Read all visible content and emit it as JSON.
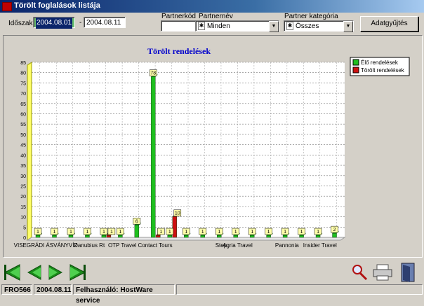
{
  "window": {
    "title": "Törölt foglalások listája"
  },
  "filters": {
    "period_label": "Időszak",
    "date_from": "2004.08.01",
    "separator": "-",
    "date_to": "2004.08.11",
    "partner_code_label": "Partnerkód",
    "partner_code_value": "",
    "partner_name_label": "Partnernév",
    "partner_name_value": "Minden",
    "partner_category_label": "Partner kategória",
    "partner_category_value": "Összes",
    "data_button": "Adatgyűjtés"
  },
  "chart_data": {
    "type": "bar",
    "title": "Törölt rendelések",
    "ylim": [
      0,
      85
    ],
    "yticks": [
      0,
      5,
      10,
      15,
      20,
      25,
      30,
      35,
      40,
      45,
      50,
      55,
      60,
      65,
      70,
      75,
      80,
      85
    ],
    "grid": true,
    "legend_position": "top-right",
    "categories": [
      "VISEGRÁDI ÁSVÁNYVÍZ",
      "",
      "",
      "Danubius Rt",
      "",
      "OTP Travel",
      "",
      "Contact Tours",
      "",
      "",
      "",
      "Step",
      "Agria Travel",
      "",
      "",
      "Pannonia",
      "",
      "Insider Travel",
      ""
    ],
    "xlabels": [
      "VISEGRÁDI ÁSVÁNYVÍZ",
      "Danubius Rt",
      "OTP Travel",
      "Contact Tours",
      "Step",
      "Agria Travel",
      "Pannonia",
      "Insider Travel"
    ],
    "series": [
      {
        "name": "Élő rendelések",
        "color": "#1fbf1f",
        "values": [
          1,
          1,
          1,
          1,
          1,
          1,
          6,
          78,
          1,
          1,
          1,
          1,
          1,
          1,
          1,
          1,
          1,
          1,
          2
        ]
      },
      {
        "name": "Törölt rendelések",
        "color": "#cc1010",
        "values": [
          0,
          0,
          0,
          0,
          1,
          0,
          0,
          1,
          10,
          0,
          0,
          0,
          0,
          0,
          0,
          0,
          0,
          0,
          0
        ]
      }
    ]
  },
  "navigation": {
    "first_icon": "first-record-icon",
    "prev_icon": "previous-record-icon",
    "next_icon": "next-record-icon",
    "last_icon": "last-record-icon",
    "search_icon": "magnifier-icon",
    "print_icon": "printer-icon",
    "exit_icon": "exit-door-icon"
  },
  "status": {
    "code": "FRO566",
    "date": "2004.08.11",
    "user": "Felhasználó: HostWare service"
  }
}
